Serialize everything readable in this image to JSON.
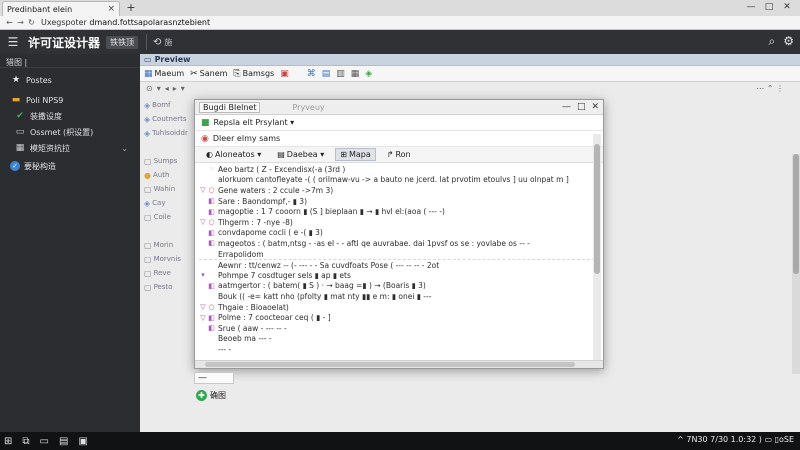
{
  "browser": {
    "tab_title": "Predinbant elein",
    "tab_close": "×",
    "new_tab": "+",
    "window_controls": [
      "—",
      "□",
      "✕"
    ],
    "url_prefix": "Uxegspoter",
    "url_host": "dmand.fottsapolarasnztebient"
  },
  "app": {
    "title": "许可证设计器",
    "badge": "铁铁顶",
    "header_text": "施",
    "header_right_icons": [
      "search-icon",
      "gear-icon"
    ]
  },
  "sidebar": {
    "section": "猎图 |",
    "items": [
      {
        "label": "Postes",
        "icon": "★"
      },
      {
        "label": "Poli NPS9",
        "icon": "▬"
      },
      {
        "label": "装撒设度",
        "icon": "✔"
      },
      {
        "label": "Ossmet (枳设置)",
        "icon": "▭"
      },
      {
        "label": "模矩资抗拉",
        "icon": "▦",
        "chevron": "⌄"
      },
      {
        "label": "要秘构造",
        "icon": "✓"
      }
    ]
  },
  "main": {
    "panel_title": "Preview",
    "toolbar": [
      {
        "label": "Maeum",
        "icon": "▦"
      },
      {
        "label": "Sanem",
        "icon": "✂"
      },
      {
        "label": "Bamsgs",
        "icon": "⎘"
      }
    ],
    "toolbar_icons": [
      "▣",
      "⌘",
      "▤",
      "▥",
      "▦",
      "◈"
    ],
    "row2": [
      "⊙",
      "▾",
      "◂",
      "▸",
      "▾"
    ],
    "row2_right": "⋯  ⌃  ⋮",
    "tree": [
      "Bomf",
      "Coutnerts",
      "Tuhlsoiddr",
      "",
      "Sumps",
      "Auth",
      "Wahin",
      "Cay",
      "Coile",
      "",
      "Morin",
      "Morvnis",
      "Reve",
      "Pesto"
    ]
  },
  "dialog": {
    "select": "Bugdi Blelnet",
    "title2": "Pryveuy",
    "controls": [
      "—",
      "□",
      "✕"
    ],
    "row1": "Repsla elt Prsylant ▾",
    "row2": "Dleer elmy sams",
    "filters": [
      {
        "label": "Aloneatos ▾",
        "icon": "◐"
      },
      {
        "label": "Daebea ▾",
        "icon": "▤"
      },
      {
        "label": "Mapa",
        "icon": "⊞"
      },
      {
        "label": "Ron",
        "icon": "↱"
      }
    ],
    "lines": [
      {
        "mk": "",
        "gl": "◦",
        "t": "Aeo bartz ( Z - Excendisx(-a (3rd )",
        "d": ""
      },
      {
        "mk": "",
        "gl": "",
        "t": "  alorkuom cantofleyate -( ( orilmaw-vu -> a  bauto ne jcerd. lat prvotim etoulvs ] uu olnpat m ]",
        "d": ""
      },
      {
        "mk": "▽",
        "gl": "○",
        "t": "  Gene waters : 2 ccule ->7m 3)",
        "d": ""
      },
      {
        "mk": "",
        "gl": "◧",
        "t": "    Sare : Baondompf,- ▮ 3)",
        "d": ""
      },
      {
        "mk": "",
        "gl": "◧",
        "t": "    magoptie : 1 7  cooorn ▮ (S ] bieplaan ▮  → ▮ hvl el:(aoa  ( --- -)",
        "d": ""
      },
      {
        "mk": "▽",
        "gl": "○",
        "t": "  Tlhgerm : 7   -nye -8)",
        "d": ""
      },
      {
        "mk": "",
        "gl": "◧",
        "t": "    convdapome cocli ( e  -( ▮ 3)",
        "d": ""
      },
      {
        "mk": "",
        "gl": "◧",
        "t": "    mageotos : ( batm,ntsg - -as el -  - aftl qe auvrabae. dai 1pvsf os se : yovlabe os  --  -",
        "d": ""
      },
      {
        "mk": "",
        "gl": "",
        "t": "    Errapolidom",
        "d": ""
      },
      {
        "mk": "",
        "gl": "",
        "t": "Aewnr : tt/cenwz  -- (- ---  - -  Sa cuvdfoats Pose  (  ---  -- --     - 2ot",
        "d": ""
      },
      {
        "mk": "▾",
        "gl": "",
        "t": "  Pohmpe 7 cosdtuger sels  ▮ ap ▮ ets",
        "d": ""
      },
      {
        "mk": "",
        "gl": "◧",
        "t": "    aatmgertor : ( batem(  ▮ S ) · → baag =▮ )   → (Boaris ▮ 3)",
        "d": ""
      },
      {
        "mk": "",
        "gl": "",
        "t": "    Bouk (( -e= katt nho (pfolty  ▮ mat nty ▮▮   e  m:  ▮ onei ▮ ---",
        "d": ""
      },
      {
        "mk": "▽",
        "gl": "○",
        "t": "  Thgaie : Bioaoelat)",
        "d": ""
      },
      {
        "mk": "▽",
        "gl": "◧",
        "t": "    Polme : 7 coocteoar ceq ( ▮ - ]",
        "d": ""
      },
      {
        "mk": "",
        "gl": "◧",
        "t": "    Srue ( aaw - ---  -- -",
        "d": ""
      },
      {
        "mk": "",
        "gl": "",
        "t": "  Beoeb ma   ---    -",
        "d": ""
      },
      {
        "mk": "",
        "gl": "",
        "t": "   ---                      -",
        "d": ""
      }
    ]
  },
  "below": {
    "minus": "—",
    "ok_label": "确图",
    "ok_icon": "✚"
  },
  "taskbar": {
    "icons": [
      "⊞",
      "⧉",
      "▭",
      "▤",
      "▣"
    ],
    "tray": "^ 7N30 7/30 1.0:32 )  ▭ ▯oSE"
  }
}
